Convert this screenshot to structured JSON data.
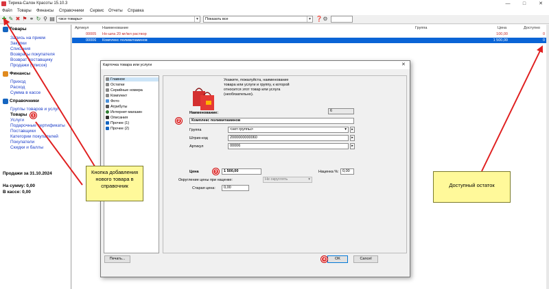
{
  "window": {
    "title": "Тирика-Салон Красоты 15.10.3",
    "minimize": "—",
    "maximize": "□",
    "close": "✕"
  },
  "menu": [
    "Файл",
    "Товары",
    "Финансы",
    "Справочники",
    "Сервис",
    "Отчеты",
    "Справка"
  ],
  "toolbar": {
    "filter_group": "<все товары>",
    "filter_show": "Показать все",
    "search_value": "",
    "icons": [
      "add-icon",
      "edit-icon",
      "delete-icon",
      "flag-icon",
      "link-icon",
      "refresh-icon",
      "search-icon",
      "print-icon",
      "help-icon",
      "settings-icon"
    ]
  },
  "sidebar": {
    "sections": [
      {
        "title": "Товары",
        "color": "#1565c0",
        "items": [
          "Запись на прием",
          "Закупки",
          "Списания",
          "Возвраты покупателя",
          "Возврат поставщику",
          "Продажи (список)"
        ]
      },
      {
        "title": "Финансы",
        "color": "#e08a1e",
        "items": [
          "Приход",
          "Расход",
          "Сумма в кассе"
        ]
      },
      {
        "title": "Справочники",
        "color": "#1565c0",
        "items": [
          "Группы товаров и услуг",
          "Товары",
          "Услуги",
          "Подарочные сертификаты",
          "Поставщики",
          "Категории покупателей",
          "Покупатели",
          "Скидки и баллы"
        ]
      }
    ],
    "sales_title": "Продажи за 31.10.2024",
    "total_label": "На сумму: 0,00",
    "cash_label": "В кассе: 0,00"
  },
  "table": {
    "columns": [
      "Артикул",
      "Наименование",
      "Группа",
      "Цена",
      "Доступно"
    ],
    "rows": [
      {
        "article": "00005",
        "name": "Но-шпа 20 мг/мл раствор",
        "group": "",
        "price": "100,00",
        "available": "0"
      },
      {
        "article": "00006",
        "name": "Комплекс поливитаминов",
        "group": "",
        "price": "1 500,00",
        "available": "0"
      }
    ]
  },
  "dialog": {
    "title": "Карточка товара или услуги",
    "close": "✕",
    "tree": [
      "Главное",
      "Остатки",
      "Серийные номера",
      "Комплект",
      "Фото",
      "Атрибуты",
      "Интернет-магазин",
      "Описания",
      "Прочее (1)",
      "Прочее (2)"
    ],
    "hint": "Укажите, пожалуйста, наименование товара или услуги и группу, к которой относится этот товар или услуга (необязательно).",
    "name_label": "Наименование:",
    "name_value": "Комплекс поливитаминов",
    "number_value": "6",
    "group_label": "Группа",
    "group_value": "<нет группы>",
    "barcode_label": "Штрих-код",
    "barcode_value": "2000000000060",
    "article_label": "Артикул",
    "article_value": "00006",
    "price_label": "Цена",
    "price_value": "1 500,00",
    "markup_label": "Наценка %:",
    "markup_value": "0,00",
    "rounding_label": "Округление цены при наценке:",
    "rounding_value": "Не округлять",
    "old_price_label": "Старая цена:",
    "old_price_value": "0,00",
    "print_button": "Печать...",
    "ok_button": "OK",
    "cancel_button": "Cancel"
  },
  "annotations": {
    "badges": [
      "1",
      "2",
      "3",
      "4"
    ],
    "note_new_item": "Кнопка добавления нового товара в справочник",
    "note_stock": "Доступный остаток",
    "arrow_color": "#e02020",
    "note_color": "#fff99a"
  }
}
